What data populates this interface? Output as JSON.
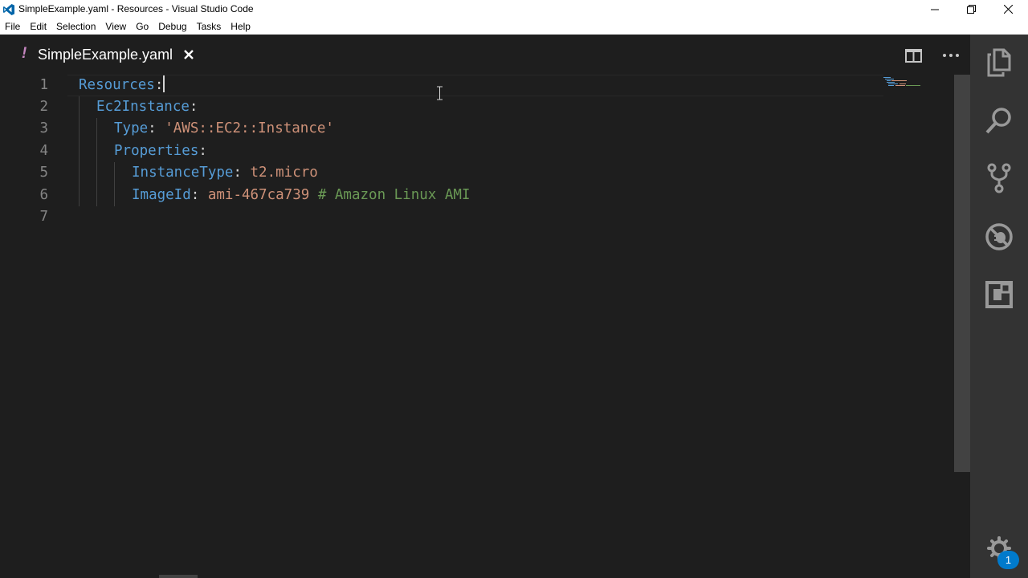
{
  "window": {
    "title": "SimpleExample.yaml - Resources - Visual Studio Code",
    "app_icon": "vscode-logo-icon",
    "controls": [
      "minimize-icon",
      "restore-icon",
      "close-icon"
    ]
  },
  "menu": {
    "items": [
      "File",
      "Edit",
      "Selection",
      "View",
      "Go",
      "Debug",
      "Tasks",
      "Help"
    ]
  },
  "tab": {
    "modified_marker": "!",
    "label": "SimpleExample.yaml",
    "close_icon": "close-icon"
  },
  "editor_actions": [
    "split-editor-icon",
    "more-actions-icon"
  ],
  "editor": {
    "line_numbers": [
      "1",
      "2",
      "3",
      "4",
      "5",
      "6",
      "7"
    ],
    "lines": [
      {
        "key": "Resources",
        "punct": ":"
      },
      {
        "key": "Ec2Instance",
        "punct": ":"
      },
      {
        "key": "Type",
        "punct": ": ",
        "value": "'AWS::EC2::Instance'"
      },
      {
        "key": "Properties",
        "punct": ":"
      },
      {
        "key": "InstanceType",
        "punct": ": ",
        "value": "t2.micro"
      },
      {
        "key": "ImageId",
        "punct": ": ",
        "value": "ami-467ca739",
        "comment": " # Amazon Linux AMI"
      },
      {
        "key": ""
      }
    ]
  },
  "activity_bar": {
    "items": [
      "explorer-icon",
      "search-icon",
      "source-control-icon",
      "debug-icon",
      "extensions-icon"
    ],
    "settings_icon": "gear-icon",
    "badge": "1"
  },
  "colors": {
    "background": "#1e1e1e",
    "key": "#569cd6",
    "string": "#ce9178",
    "comment": "#6a9955",
    "activity_bar": "#333333",
    "badge": "#007acc",
    "modified": "#c586c0"
  }
}
